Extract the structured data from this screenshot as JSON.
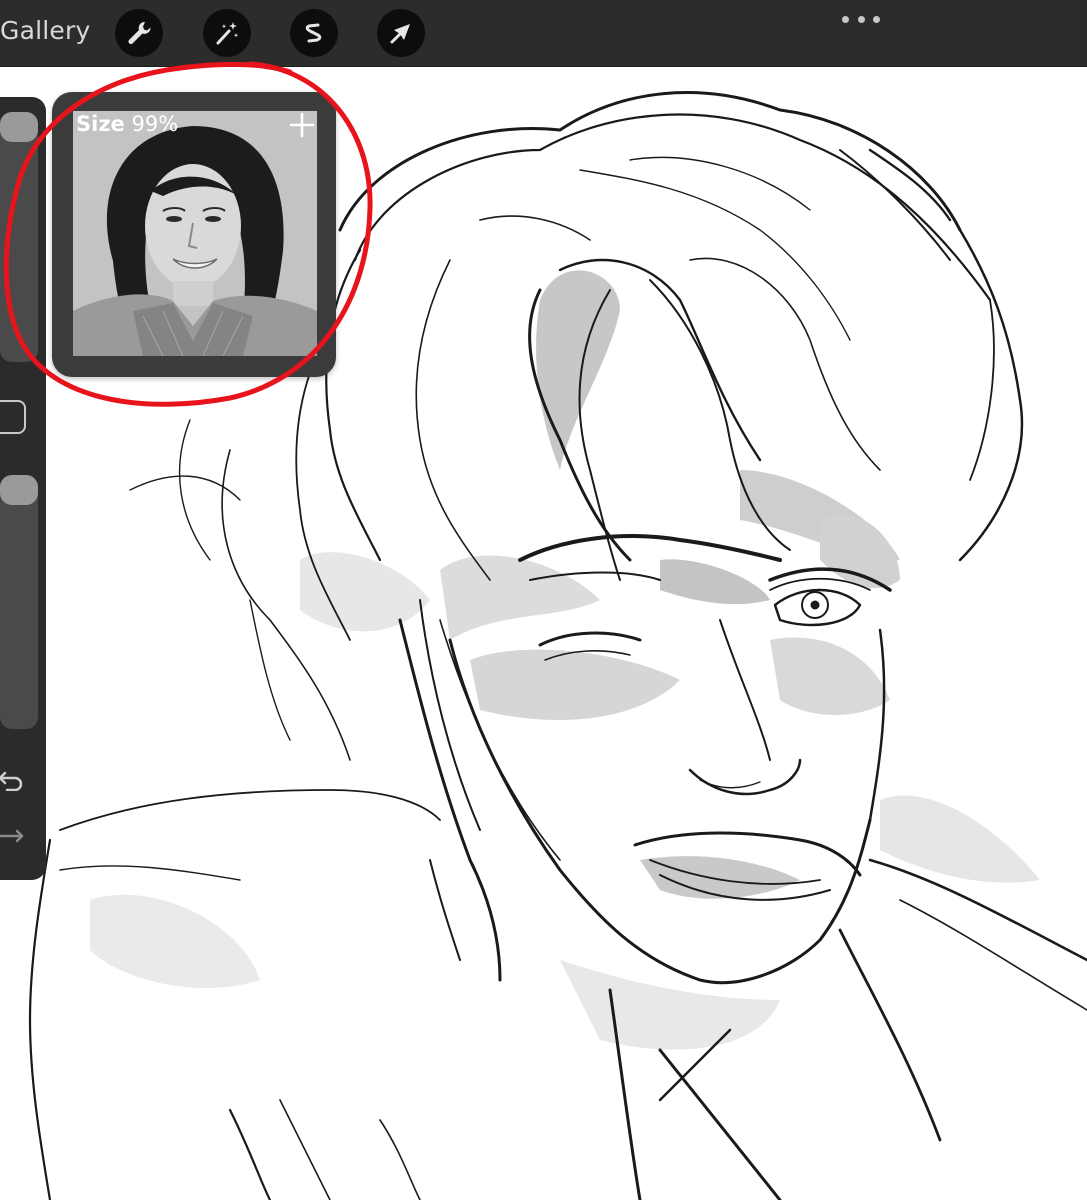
{
  "topbar": {
    "gallery_label": "Gallery",
    "tools": [
      {
        "icon": "wrench-icon",
        "name": "actions"
      },
      {
        "icon": "magic-wand-icon",
        "name": "adjustments"
      },
      {
        "icon": "selection-icon",
        "name": "selection"
      },
      {
        "icon": "transform-arrow-icon",
        "name": "transform"
      }
    ],
    "more_icon": "more-dots-icon"
  },
  "sidebar": {
    "top_slider": "brush-size-slider",
    "modify_button": "modify-square-icon",
    "bottom_slider": "opacity-slider",
    "undo_icon": "undo-arrow-icon",
    "redo_icon": "redo-arrow-icon"
  },
  "reference": {
    "size_label": "Size",
    "size_value": "99%",
    "add_icon": "plus-icon"
  },
  "colors": {
    "toolbar_bg": "#2c2c2c",
    "sidebar_bg": "#2b2b2b",
    "annotation_red": "#e8141c",
    "canvas_bg": "#ffffff"
  }
}
